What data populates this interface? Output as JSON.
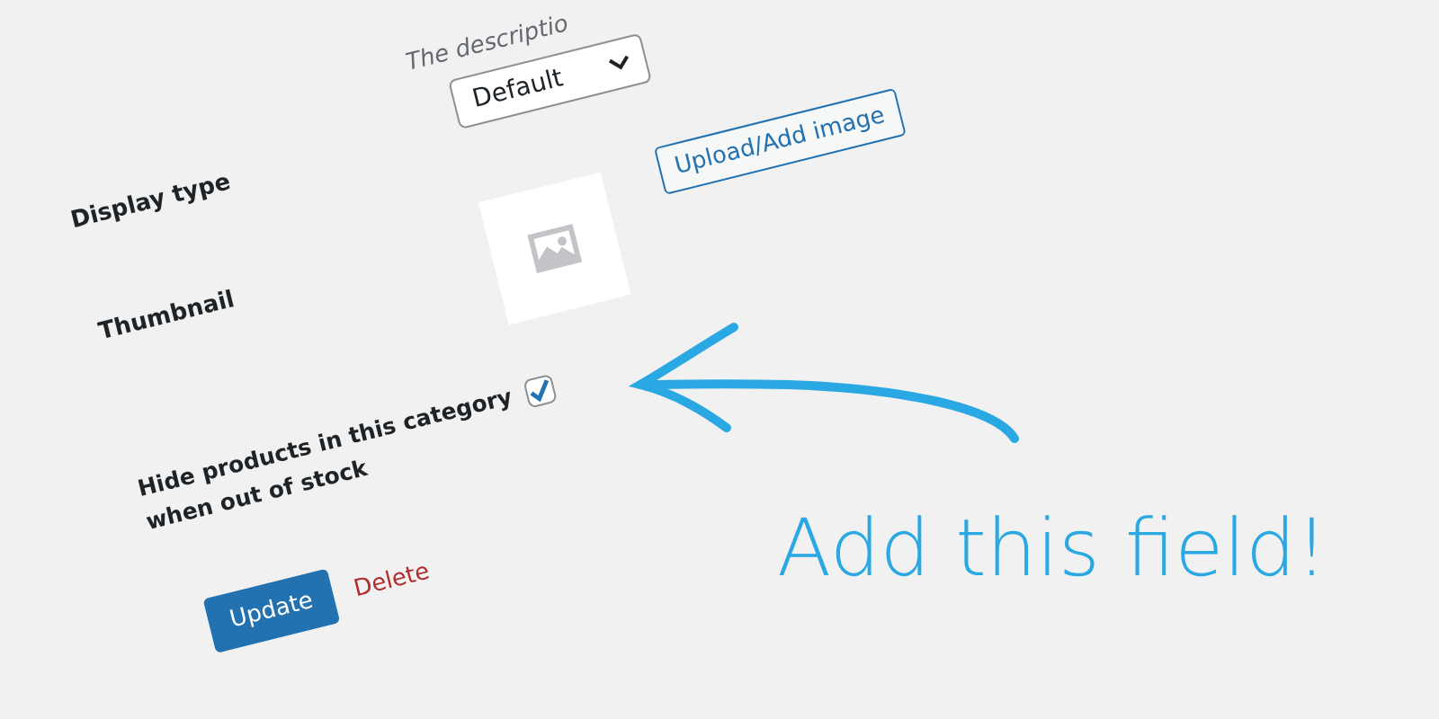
{
  "description_hint": "The descriptio",
  "display_type": {
    "label": "Display type",
    "value": "Default"
  },
  "thumbnail": {
    "label": "Thumbnail",
    "button": "Upload/Add image"
  },
  "hide_out_of_stock": {
    "label": "Hide products in this category when out of stock",
    "checked": true
  },
  "actions": {
    "update": "Update",
    "delete": "Delete"
  },
  "annotation": {
    "text": "Add this field!"
  }
}
